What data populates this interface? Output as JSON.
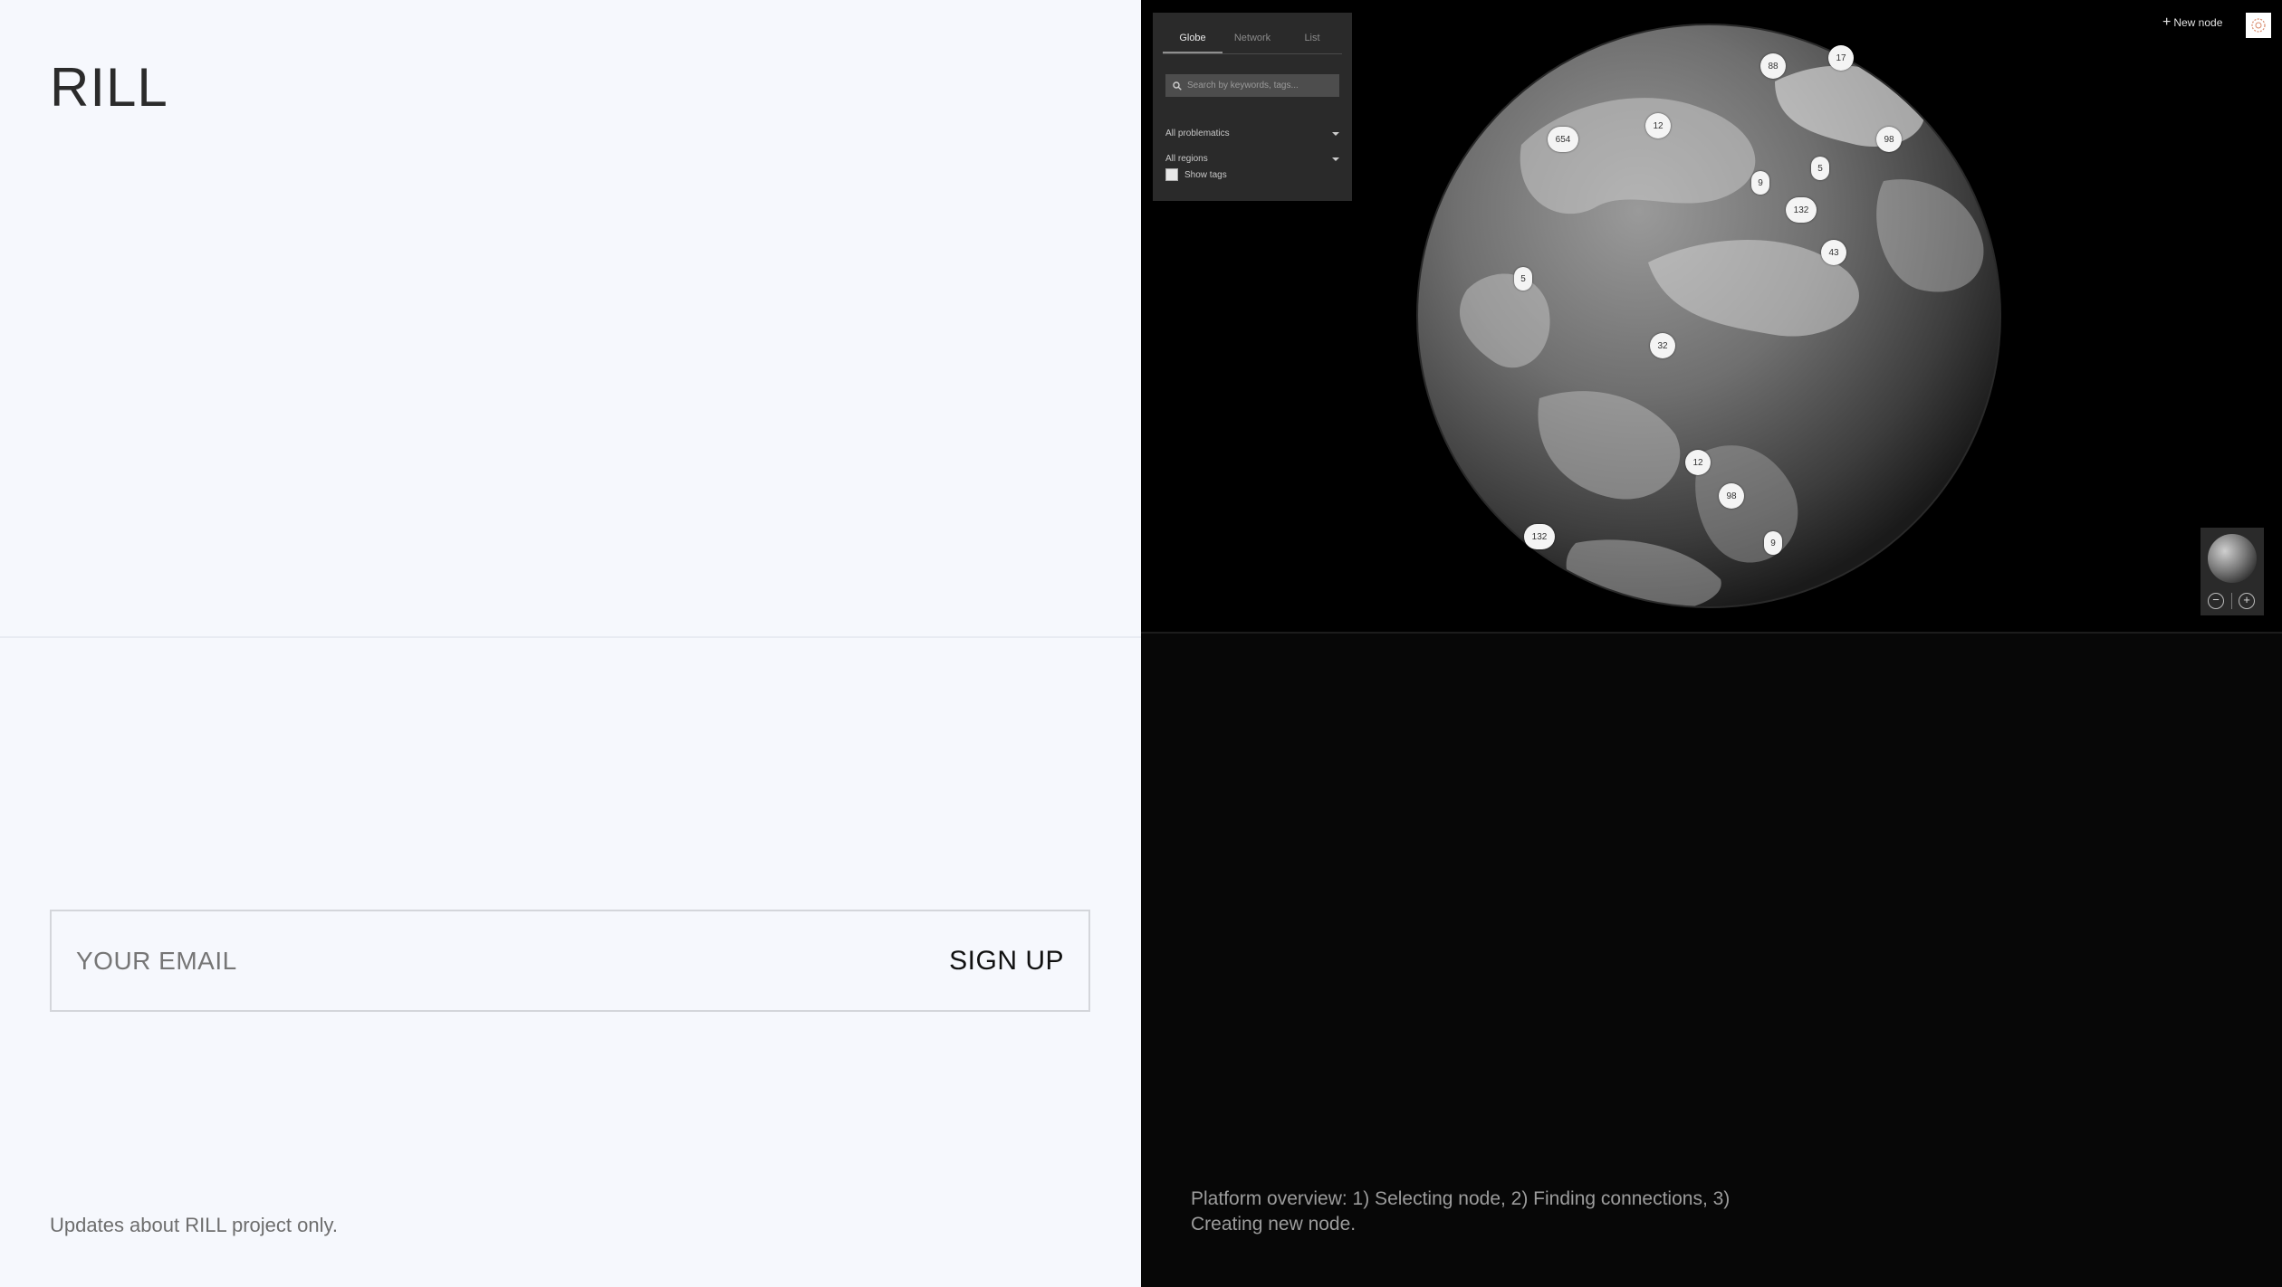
{
  "brand": {
    "title": "RILL"
  },
  "signup": {
    "email_placeholder": "YOUR EMAIL",
    "button_label": "SIGN UP"
  },
  "footer": {
    "note": "Updates about RILL project only."
  },
  "demo": {
    "panel": {
      "tabs": [
        {
          "label": "Globe",
          "active": true
        },
        {
          "label": "Network",
          "active": false
        },
        {
          "label": "List",
          "active": false
        }
      ],
      "search_placeholder": "Search by keywords, tags...",
      "filter_problematics": "All problematics",
      "filter_regions": "All regions",
      "show_tags_label": "Show tags"
    },
    "new_node_label": "New node",
    "markers": [
      "88",
      "17",
      "12",
      "654",
      "98",
      "5",
      "9",
      "132",
      "43",
      "5",
      "32",
      "12",
      "98",
      "132",
      "9"
    ],
    "zoom_out_icon": "minus-circle-icon",
    "zoom_in_icon": "plus-circle-icon"
  },
  "caption": {
    "text": "Platform overview: 1) Selecting node, 2) Finding connections, 3) Creating new node."
  },
  "colors": {
    "page_bg": "#f6f8fd",
    "demo_bg": "#000000",
    "panel_bg": "#2a2a2a",
    "marker_bg": "#f4f4f4"
  }
}
